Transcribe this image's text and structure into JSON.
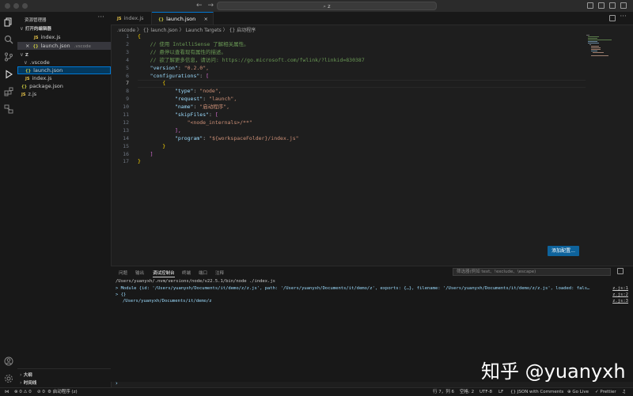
{
  "titlebar": {
    "search_text": "z"
  },
  "sidebar": {
    "title": "资源管理器",
    "open_editors_header": "打开的编辑器",
    "open_editors": [
      {
        "label": "index.js",
        "icon": "JS"
      },
      {
        "label": "launch.json",
        "detail": ".vscode",
        "icon": "{}",
        "close": "×"
      }
    ],
    "folder_name": "Z",
    "tree": [
      {
        "label": ".vscode",
        "icon": "chevron-down-icon"
      },
      {
        "label": "launch.json",
        "icon": "{}"
      },
      {
        "label": "index.js",
        "icon": "JS"
      },
      {
        "label": "package.json",
        "icon": "{}"
      },
      {
        "label": "z.js",
        "icon": "JS"
      }
    ],
    "outline": "大纲",
    "timeline": "时间线"
  },
  "tabs": [
    {
      "label": "index.js",
      "icon": "JS",
      "active": false
    },
    {
      "label": "launch.json",
      "icon": "{}",
      "active": true,
      "close": "×"
    }
  ],
  "breadcrumb": ".vscode  〉 {} launch.json 〉 Launch Targets 〉 {} 启动程序",
  "editor": {
    "line_numbers": [
      "1",
      "2",
      "3",
      "4",
      "5",
      "6",
      "7",
      "8",
      "9",
      "10",
      "11",
      "12",
      "13",
      "14",
      "15",
      "16",
      "17"
    ],
    "code": [
      "{",
      "    // 使用 IntelliSense 了解相关属性。",
      "    // 悬停以查看现有属性的描述。",
      "    // 欲了解更多信息，请访问: https://go.microsoft.com/fwlink/?linkid=830387",
      "    \"version\": \"0.2.0\",",
      "    \"configurations\": [",
      "        {",
      "            \"type\": \"node\",",
      "            \"request\": \"launch\",",
      "            \"name\": \"启动程序\",",
      "            \"skipFiles\": [",
      "                \"<node_internals>/**\"",
      "            ],",
      "            \"program\": \"${workspaceFolder}/index.js\"",
      "        }",
      "    ]",
      "}"
    ],
    "add_config_button": "添加配置..."
  },
  "panel": {
    "tabs": [
      "问题",
      "输出",
      "调试控制台",
      "终端",
      "端口",
      "注释"
    ],
    "active_tab": "调试控制台",
    "filter_placeholder": "筛选器(例如 text、!exclude、\\escape)",
    "lines": [
      {
        "text": "/Users/yuanyxh/.nvm/versions/node/v22.5.1/bin/node ./index.js",
        "source": ""
      },
      {
        "text": "> Module {id: '/Users/yuanyxh/Documents/it/demo/z/z.js', path: '/Users/yuanyxh/Documents/it/demo/z', exports: {…}, filename: '/Users/yuanyxh/Documents/it/demo/z/z.js', loaded: false, …}",
        "source": "z.js:1"
      },
      {
        "text": "> {}",
        "source": "z.js:2"
      },
      {
        "text": "/Users/yuanyxh/Documents/it/demo/z",
        "source": "z.js:3"
      }
    ]
  },
  "statusbar": {
    "errors": "0",
    "warnings": "0",
    "ports": "0",
    "launch": "启动程序 (z)",
    "position": "行 7，列 6",
    "spaces": "空格: 2",
    "encoding": "UTF-8",
    "eol": "LF",
    "language": "{} JSON with Comments",
    "golive": "Go Live",
    "prettier": "✓ Prettier"
  },
  "watermark": "知乎 @yuanyxh"
}
